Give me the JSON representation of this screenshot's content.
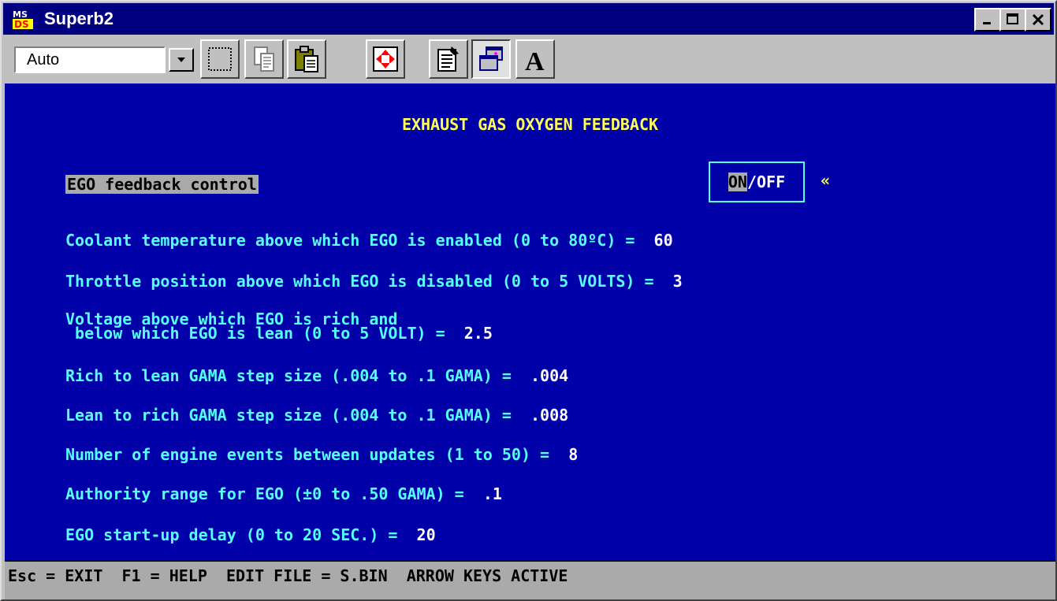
{
  "window": {
    "title": "Superb2",
    "icon": "ms-dos-icon",
    "controls": {
      "minimize": "_",
      "maximize": "□",
      "close": "×"
    }
  },
  "toolbar": {
    "font_size_value": "Auto",
    "tools": [
      "mark-icon",
      "copy-icon",
      "paste-icon",
      "fullscreen-icon",
      "properties-icon",
      "background-icon",
      "font-icon"
    ]
  },
  "screen": {
    "heading": "EXHAUST GAS OXYGEN FEEDBACK",
    "ego_label": "EGO feedback control",
    "toggle": {
      "on": "ON",
      "sep": "/",
      "off": "OFF",
      "selected": "ON"
    },
    "marker": "«",
    "fields": [
      {
        "label": "Coolant temperature above which EGO is enabled (0 to 80ºC) =  ",
        "value": "60"
      },
      {
        "label": "Throttle position above which EGO is disabled (0 to 5 VOLTS) =  ",
        "value": "3"
      },
      {
        "label": "Voltage above which EGO is rich and\n below which EGO is lean (0 to 5 VOLT) =  ",
        "value": "2.5"
      },
      {
        "label": "Rich to lean GAMA step size (.004 to .1 GAMA) =  ",
        "value": ".004"
      },
      {
        "label": "Lean to rich GAMA step size (.004 to .1 GAMA) =  ",
        "value": ".008"
      },
      {
        "label": "Number of engine events between updates (1 to 50) =  ",
        "value": "8"
      },
      {
        "label": "Authority range for EGO (±0 to .50 GAMA) =  ",
        "value": ".1"
      },
      {
        "label": "EGO start-up delay (0 to 20 SEC.) =  ",
        "value": "20"
      }
    ]
  },
  "statusbar": {
    "text": "Esc = EXIT  F1 = HELP  EDIT FILE = S.BIN  ARROW KEYS ACTIVE"
  },
  "colors": {
    "screen_bg": "#0000a8",
    "heading": "#ffff55",
    "text": "#55ffff",
    "value": "#ffffff",
    "titlebar": "#000080"
  }
}
